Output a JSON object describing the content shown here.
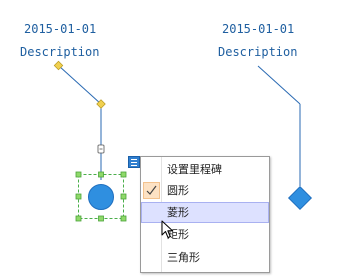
{
  "milestones": [
    {
      "date": "2015-01-01",
      "description": "Description"
    },
    {
      "date": "2015-01-01",
      "description": "Description"
    }
  ],
  "context_menu": {
    "items": [
      {
        "label": "设置里程碑",
        "checked": false,
        "highlighted": false
      },
      {
        "label": "圆形",
        "checked": true,
        "highlighted": false
      },
      {
        "label": "菱形",
        "checked": false,
        "highlighted": true
      },
      {
        "label": "矩形",
        "checked": false,
        "highlighted": false
      },
      {
        "label": "三角形",
        "checked": false,
        "highlighted": false
      }
    ]
  },
  "colors": {
    "text": "#1f5fa0",
    "connector": "#2a6ab3",
    "shape_fill": "#2f8fe0",
    "control_point": "#f0d050",
    "selection_handle": "#7ecf5a",
    "menu_highlight": "#dde1ff"
  },
  "icons": {
    "menu_toggle": "hamburger-icon",
    "checked_item": "checkmark-icon",
    "cursor": "arrow-cursor-icon"
  }
}
